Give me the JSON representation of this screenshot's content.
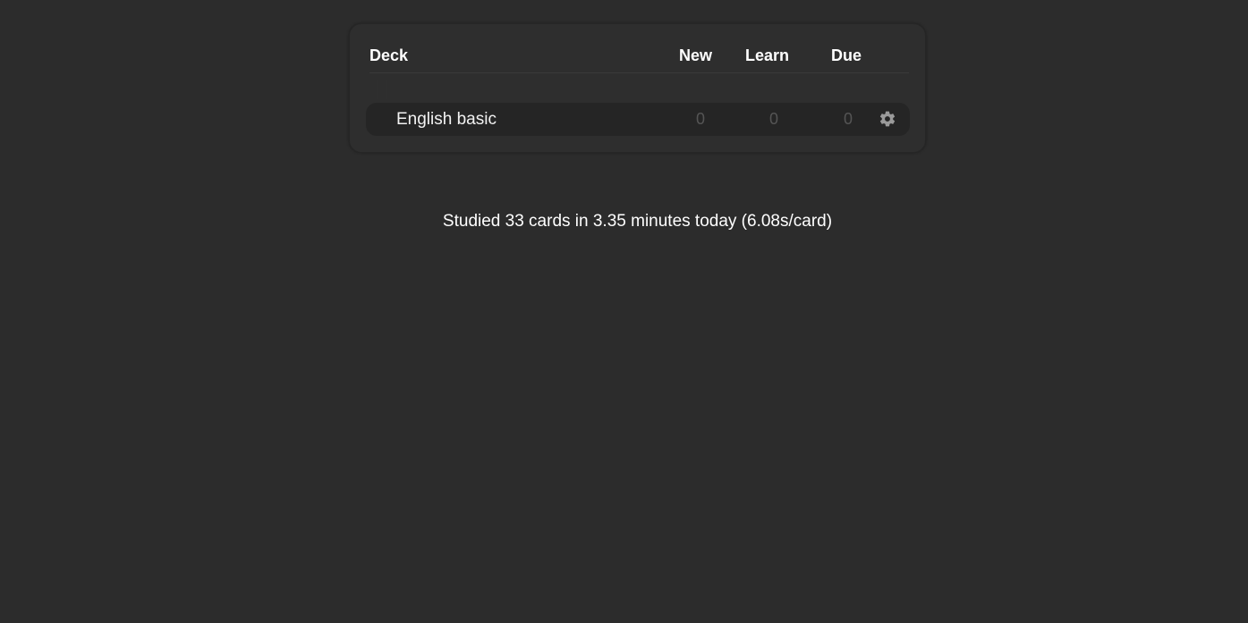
{
  "deck_table": {
    "headers": {
      "deck": "Deck",
      "new": "New",
      "learn": "Learn",
      "due": "Due"
    },
    "decks": [
      {
        "name": "English basic",
        "new": "0",
        "learn": "0",
        "due": "0",
        "options_icon": "gear-icon"
      }
    ]
  },
  "stats": {
    "text": "Studied 33 cards in 3.35 minutes today (6.08s/card)"
  },
  "colors": {
    "background": "#2c2c2c",
    "panel": "#2e2e2e",
    "row": "#252525",
    "muted_count": "#555555",
    "text": "#ffffff"
  }
}
